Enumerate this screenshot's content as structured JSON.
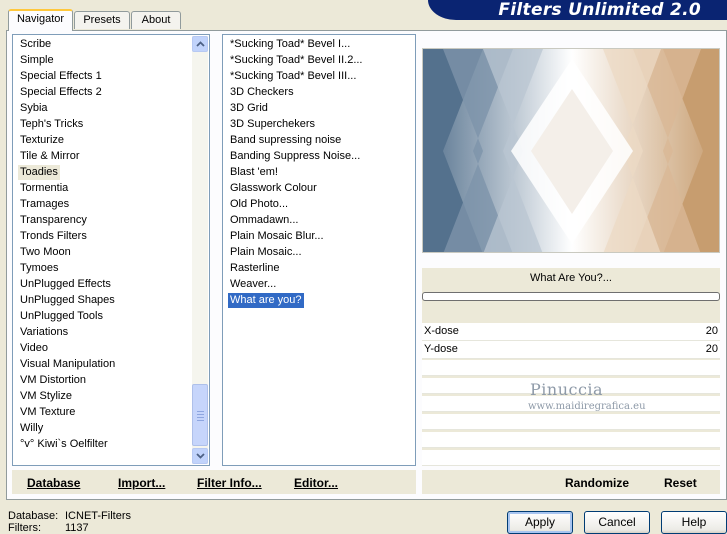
{
  "header": {
    "title": "Filters Unlimited 2.0"
  },
  "tabs": [
    {
      "label": "Navigator",
      "active": true
    },
    {
      "label": "Presets",
      "active": false
    },
    {
      "label": "About",
      "active": false
    }
  ],
  "categories": [
    "Scribe",
    "Simple",
    "Special Effects 1",
    "Special Effects 2",
    "Sybia",
    "Teph's Tricks",
    "Texturize",
    "Tile & Mirror",
    "Toadies",
    "Tormentia",
    "Tramages",
    "Transparency",
    "Tronds Filters",
    "Two Moon",
    "Tymoes",
    "UnPlugged Effects",
    "UnPlugged Shapes",
    "UnPlugged Tools",
    "Variations",
    "Video",
    "Visual Manipulation",
    "VM Distortion",
    "VM Stylize",
    "VM Texture",
    "Willy",
    "°v° Kiwi`s Oelfilter"
  ],
  "selected_category": "Toadies",
  "filters": [
    "*Sucking Toad*  Bevel I...",
    "*Sucking Toad*  Bevel II.2...",
    "*Sucking Toad*  Bevel III...",
    "3D Checkers",
    "3D Grid",
    "3D Superchekers",
    "Band supressing noise",
    "Banding Suppress Noise...",
    "Blast 'em!",
    "Glasswork Colour",
    "Old Photo...",
    "Ommadawn...",
    "Plain Mosaic Blur...",
    "Plain Mosaic...",
    "Rasterline",
    "Weaver...",
    "What are you?"
  ],
  "selected_filter": "What are you?",
  "params": {
    "filter_name": "What Are You?...",
    "sliders": [
      {
        "label": "X-dose",
        "value": "20"
      },
      {
        "label": "Y-dose",
        "value": "20"
      }
    ]
  },
  "watermark": {
    "line1": "Pinuccia",
    "line2": "www.maidiregrafica.eu"
  },
  "buttons": {
    "database": "Database",
    "import": "Import...",
    "filter_info": "Filter Info...",
    "editor": "Editor...",
    "randomize": "Randomize",
    "reset": "Reset",
    "apply": "Apply",
    "cancel": "Cancel",
    "help": "Help"
  },
  "status": {
    "database_label": "Database:",
    "database_value": "ICNET-Filters",
    "filters_label": "Filters:",
    "filters_value": "1137"
  },
  "colors": {
    "selection": "#316ac5",
    "banner": "#0a2472",
    "preview_blue": "#54718d",
    "preview_tan": "#c79d6f"
  }
}
